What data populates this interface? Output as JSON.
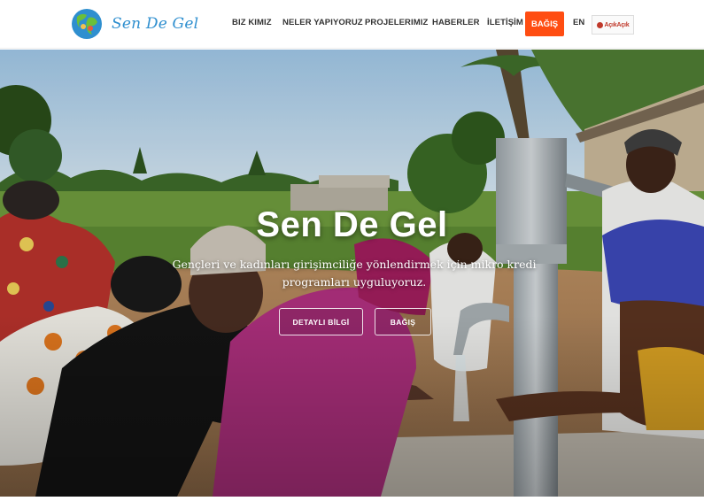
{
  "brand": {
    "name": "Sen De Gel",
    "accent": "#2f8fcf"
  },
  "nav": {
    "items": [
      "BIZ KIMIZ",
      "NELER YAPIYORUZ",
      "PROJELERIMIZ",
      "HABERLER",
      "İLETİŞİM"
    ],
    "donate_label": "BAĞIŞ",
    "donate_color": "#ff4d12",
    "language": "EN",
    "partner_logo_text": "AçıkAçık"
  },
  "hero": {
    "title": "Sen De Gel",
    "subtitle": "Gençleri ve kadınları girişimciliğe yönlendirmek için mikro kredi programları uyguluyoruz.",
    "primary_button": "DETAYLI BİLGİ",
    "secondary_button": "BAĞIŞ",
    "background_image": "women-at-water-pump-photo"
  }
}
